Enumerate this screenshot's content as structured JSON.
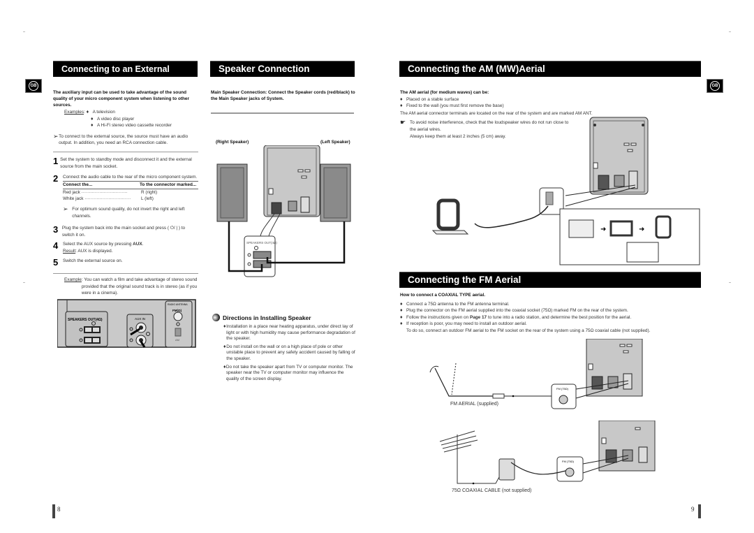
{
  "badges": {
    "language": "GB"
  },
  "left_page": {
    "page_number": "8",
    "external_source": {
      "title": "Connecting to an External Source",
      "intro": "The auxiliary input can be used to take advantage of the sound quality of your micro component system when listening to other sources.",
      "examples_label": "Examples",
      "examples": [
        "A television",
        "A video disc player",
        "A Hi-Fi stereo video cassette recorder"
      ],
      "note": "To connect to the external source, the source must have an audio output. In addition, you need an RCA connection cable.",
      "steps": [
        {
          "num": "1",
          "text": "Set the system to standby mode and disconnect it and the external source from the main socket."
        },
        {
          "num": "2",
          "text": "Connect the audio cable to the rear of the micro component system."
        },
        {
          "num": "3",
          "text": "Plug the system back into the main socket and press ( ⏻/ | ) to switch it on."
        },
        {
          "num": "4",
          "text_pre": "Select the AUX source by pressing ",
          "text_bold": "AUX",
          "text_post": ".",
          "result_label": "Result",
          "result_text": ": AUX is displayed."
        },
        {
          "num": "5",
          "text": "Switch the external source on."
        }
      ],
      "table": {
        "headers": [
          "Connect the...",
          "To the connector marked..."
        ],
        "rows": [
          {
            "left": "Red jack",
            "right": "R (right)"
          },
          {
            "left": "White jack",
            "right": "L (left)"
          }
        ]
      },
      "tip": "For optimum sound quality, do not invert the right and left channels.",
      "example_label": "Example",
      "example_text": ": You can watch a film and take advantage of stereo sound provided that the original sound track is in stereo (as if you were in a cinema).",
      "panel_labels": {
        "speakers_out": "SPEAKERS OUT(4Ω)",
        "aux_in": "AUX IN",
        "radio_antenna": "RADIO ANTENNA",
        "fm": "FM(Ω)",
        "am": "AM"
      }
    },
    "speaker_connection": {
      "title": "Speaker Connection",
      "intro": "Main Speaker Connection: Connect the Speaker cords (red/black) to the Main Speaker jacks of System.",
      "right_speaker": "(Right Speaker)",
      "left_speaker": "(Left Speaker)",
      "inset_label": "SPEAKERS OUT(4Ω)",
      "directions_title": "Directions in Installing Speaker",
      "directions": [
        "Installation in a place near heating apparatus, under direct lay of light or with high humidity may cause performance degradation of the speaker.",
        "Do not install on the wall or on a high place of pole or other unstable place to prevent any safety accident caused by falling of the speaker.",
        "Do not take the speaker apart from TV or computer monitor. The speaker near the TV or computer monitor may influence the quality of the screen display."
      ]
    }
  },
  "right_page": {
    "page_number": "9",
    "am_aerial": {
      "title": "Connecting the AM (MW)Aerial",
      "intro": "The AM aerial (for medium waves) can be:",
      "bullets": [
        "Placed on a stable surface",
        "Fixed to the wall (you must first remove the base)"
      ],
      "terminals_note": "The AM aerial connector terminals are located on the rear of the system and are marked AM ANT.",
      "warning": [
        "To avoid noise interference, check that the loudspeaker wires do not run close to the aerial wires.",
        "Always keep them at least 2 inches (5 cm) away."
      ]
    },
    "fm_aerial": {
      "title": "Connecting the FM Aerial",
      "intro": "How to connect a COAXIAL TYPE aerial.",
      "bullets": [
        {
          "text": "Connect a 75Ω antenna to the FM antenna terminal."
        },
        {
          "text": "Plug the connector on the FM aerial supplied into the coaxial socket (75Ω) marked FM on the rear of the system."
        },
        {
          "pre": "Follow the instructions given on ",
          "bold": "Page 17",
          "post": " to tune into a radio station, and determine the best position for the aerial."
        },
        {
          "text": "If reception is poor, you may need to install an outdoor aerial.",
          "sub": "To do so, connect an outdoor FM aerial to the FM socket on the rear of the system using a 75Ω coaxial cable (not supplied)."
        }
      ],
      "fm_label": "FM (75Ω)",
      "caption_supplied": "FM AERIAL (supplied)",
      "caption_coax": "75Ω COAXIAL CABLE (not supplied)"
    }
  }
}
